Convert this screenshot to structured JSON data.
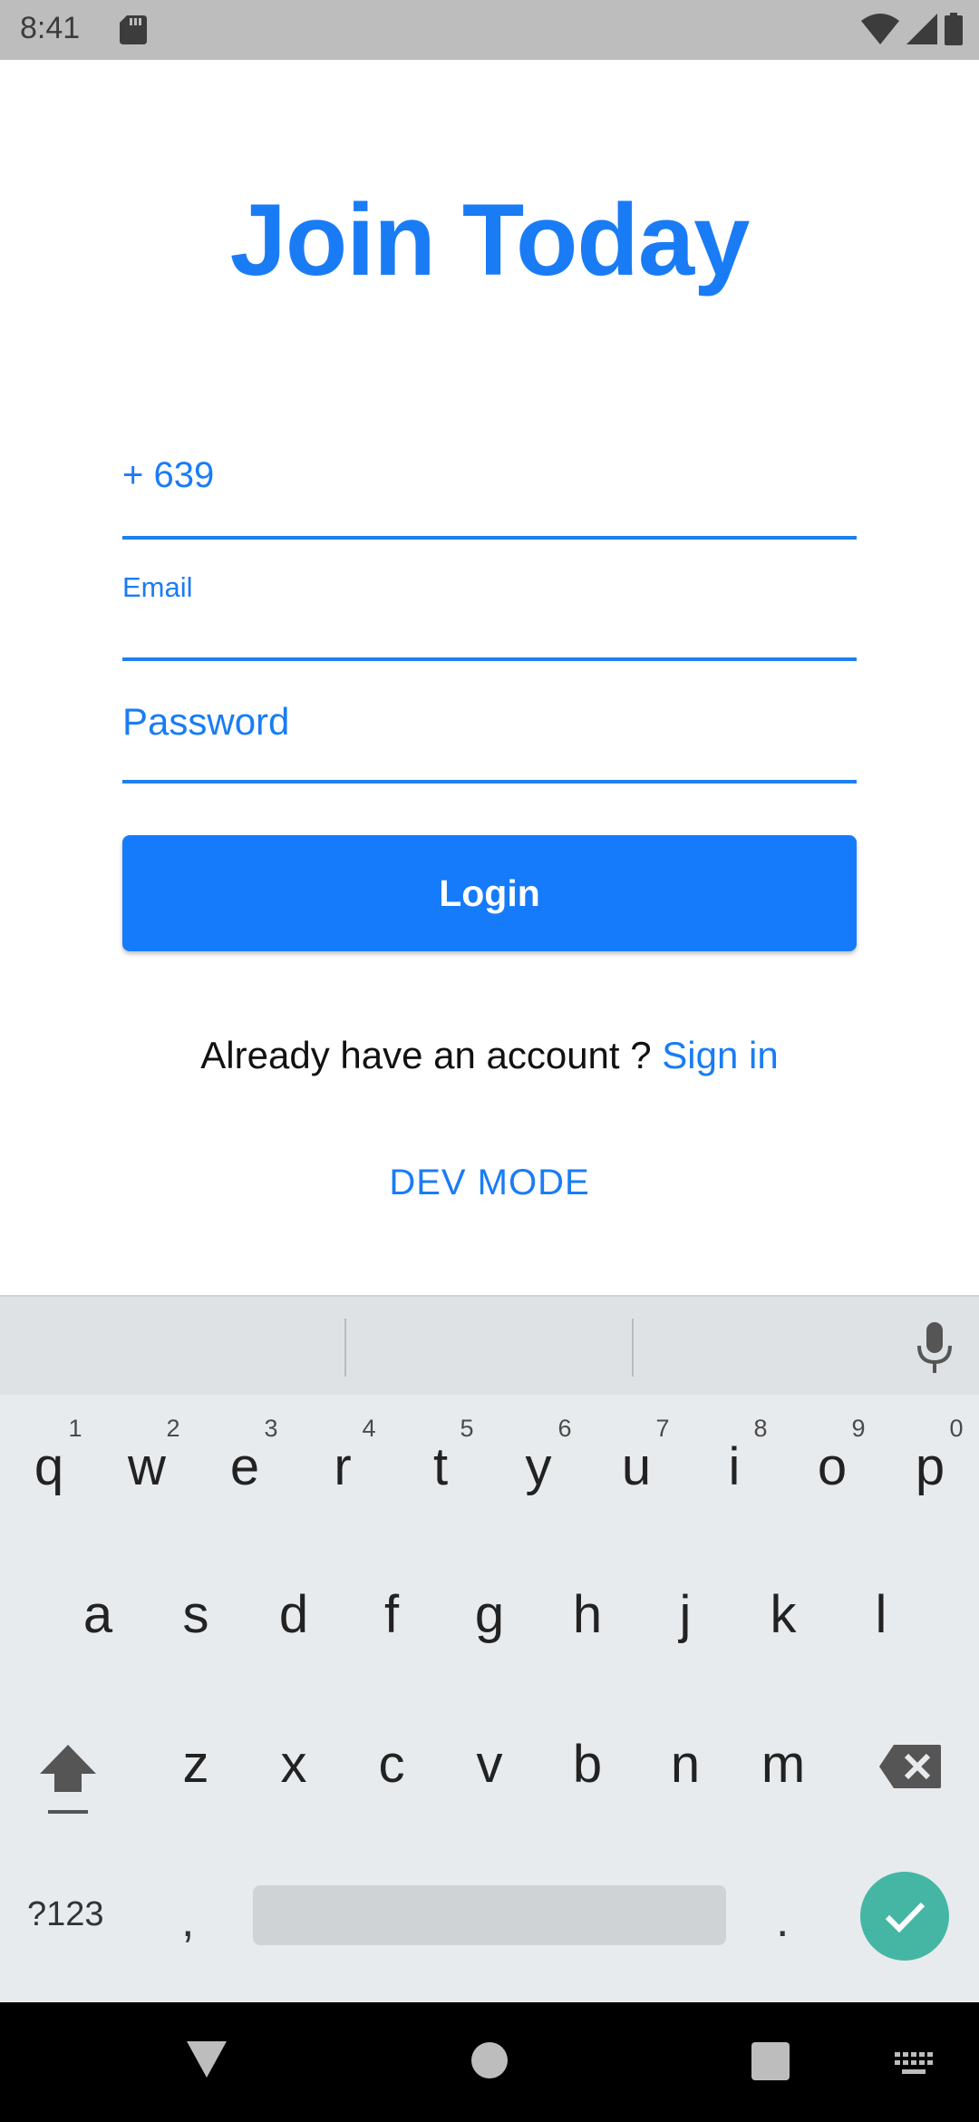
{
  "status_bar": {
    "time": "8:41",
    "icons": [
      "sd-card-icon",
      "wifi-icon",
      "signal-icon",
      "battery-icon"
    ]
  },
  "form": {
    "title": "Join Today",
    "phone_value": "+ 639",
    "email_label": "Email",
    "password_placeholder": "Password",
    "login_label": "Login",
    "account_prompt": "Already have an account ? ",
    "signin_label": "Sign in",
    "dev_mode_label": "DEV MODE"
  },
  "colors": {
    "accent": "#1a7cf5",
    "button": "#167bfb",
    "enter_key": "#45b6a4",
    "status_bar": "#bdbdbd",
    "keyboard": "#e8ebee"
  },
  "keyboard": {
    "row1": [
      "q",
      "w",
      "e",
      "r",
      "t",
      "y",
      "u",
      "i",
      "o",
      "p"
    ],
    "row1_nums": [
      "1",
      "2",
      "3",
      "4",
      "5",
      "6",
      "7",
      "8",
      "9",
      "0"
    ],
    "row2": [
      "a",
      "s",
      "d",
      "f",
      "g",
      "h",
      "j",
      "k",
      "l"
    ],
    "row3": [
      "z",
      "x",
      "c",
      "v",
      "b",
      "n",
      "m"
    ],
    "symbols_label": "?123",
    "comma": ",",
    "period": ".",
    "icons": [
      "mic-icon",
      "shift-icon",
      "backspace-icon",
      "check-icon"
    ]
  },
  "nav_bar": {
    "icons": [
      "back-icon",
      "home-icon",
      "recents-icon",
      "keyboard-switch-icon"
    ]
  }
}
